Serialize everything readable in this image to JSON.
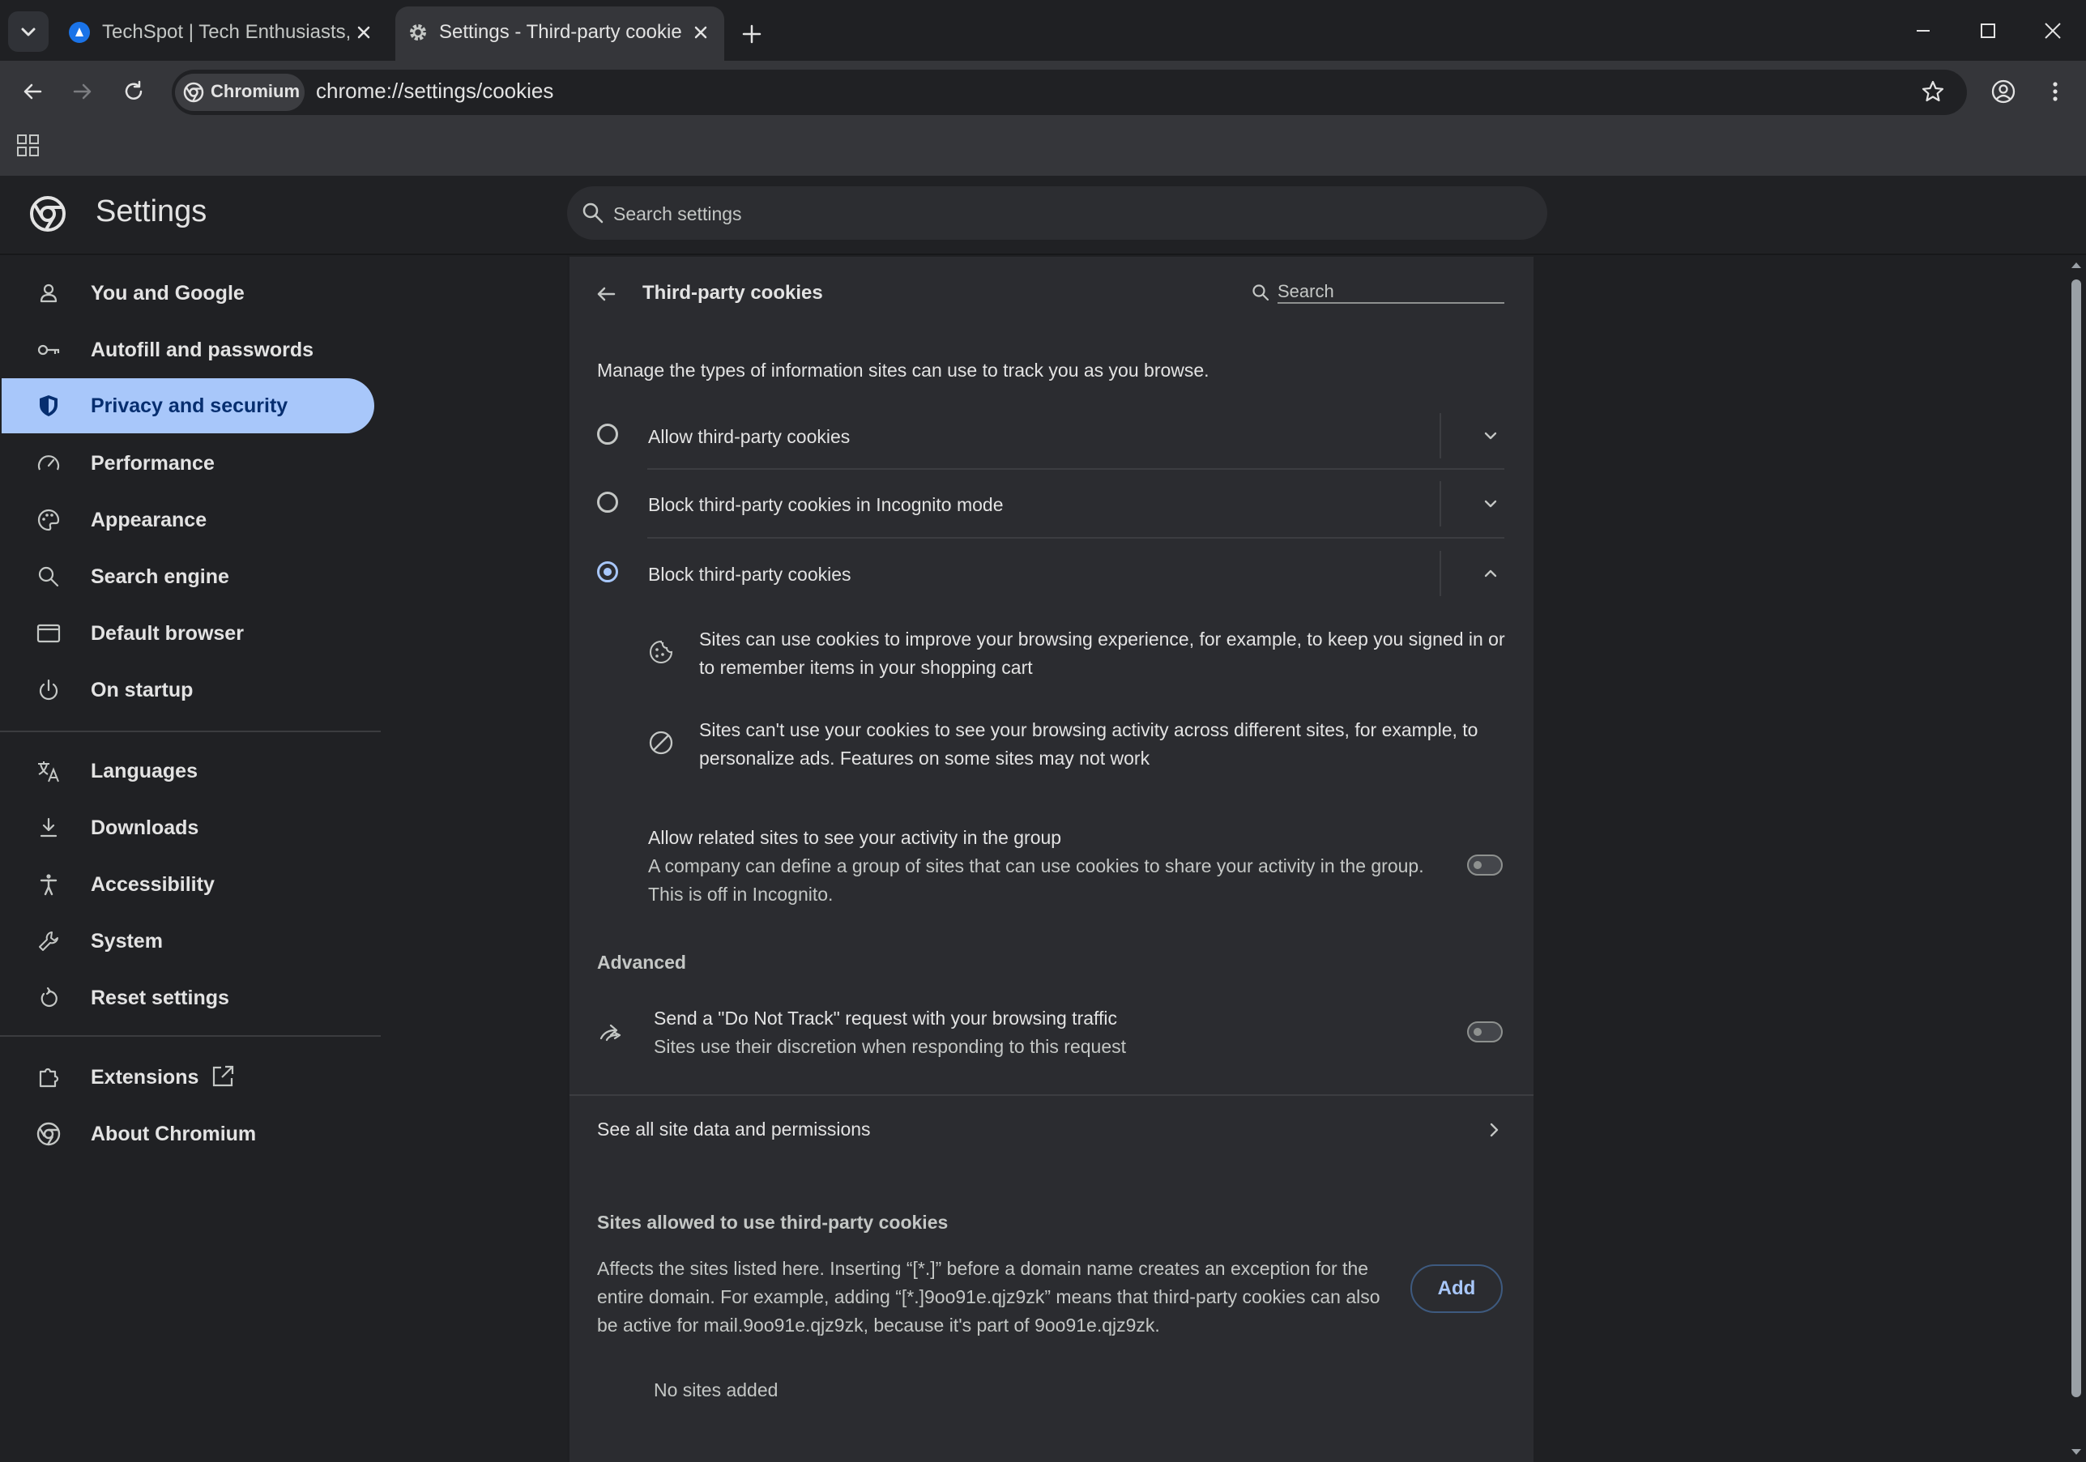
{
  "tabs": [
    {
      "title": "TechSpot | Tech Enthusiasts, Power Users, IT Professionals and Gamers",
      "active": false
    },
    {
      "title": "Settings - Third-party cookies",
      "active": true
    }
  ],
  "omnibox": {
    "chip_label": "Chromium",
    "url": "chrome://settings/cookies"
  },
  "header": {
    "title": "Settings",
    "search_placeholder": "Search settings"
  },
  "sidebar": {
    "items": [
      {
        "label": "You and Google",
        "icon": "person-icon"
      },
      {
        "label": "Autofill and passwords",
        "icon": "key-icon"
      },
      {
        "label": "Privacy and security",
        "icon": "shield-icon",
        "active": true
      },
      {
        "label": "Performance",
        "icon": "speedometer-icon"
      },
      {
        "label": "Appearance",
        "icon": "palette-icon"
      },
      {
        "label": "Search engine",
        "icon": "search-icon"
      },
      {
        "label": "Default browser",
        "icon": "browser-icon"
      },
      {
        "label": "On startup",
        "icon": "power-icon"
      },
      {
        "label": "Languages",
        "icon": "translate-icon"
      },
      {
        "label": "Downloads",
        "icon": "download-icon"
      },
      {
        "label": "Accessibility",
        "icon": "accessibility-icon"
      },
      {
        "label": "System",
        "icon": "wrench-icon"
      },
      {
        "label": "Reset settings",
        "icon": "reset-icon"
      },
      {
        "label": "Extensions",
        "icon": "puzzle-icon"
      },
      {
        "label": "About Chromium",
        "icon": "chromium-icon"
      }
    ]
  },
  "page": {
    "title": "Third-party cookies",
    "search_placeholder": "Search",
    "description": "Manage the types of information sites can use to track you as you browse.",
    "options": [
      {
        "label": "Allow third-party cookies",
        "selected": false
      },
      {
        "label": "Block third-party cookies in Incognito mode",
        "selected": false
      },
      {
        "label": "Block third-party cookies",
        "selected": true
      }
    ],
    "details": [
      {
        "line1": "Sites can use cookies to improve your browsing experience, for example, to keep you signed in or",
        "line2": "to remember items in your shopping cart"
      },
      {
        "line1": "Sites can't use your cookies to see your browsing activity across different sites, for example, to",
        "line2": "personalize ads. Features on some sites may not work"
      }
    ],
    "related_sites": {
      "title": "Allow related sites to see your activity in the group",
      "line1": "A company can define a group of sites that can use cookies to share your activity in the group.",
      "line2": "This is off in Incognito.",
      "enabled": false
    },
    "advanced_heading": "Advanced",
    "do_not_track": {
      "title": "Send a \"Do Not Track\" request with your browsing traffic",
      "subtitle": "Sites use their discretion when responding to this request",
      "enabled": false
    },
    "see_all_link": "See all site data and permissions",
    "allowed": {
      "heading": "Sites allowed to use third-party cookies",
      "line1": "Affects the sites listed here. Inserting “[*.]” before a domain name creates an exception for the",
      "line2": "entire domain. For example, adding “[*.]9oo91e.qjz9zk” means that third-party cookies can also",
      "line3": "be active for mail.9oo91e.qjz9zk, because it's part of 9oo91e.qjz9zk.",
      "add_label": "Add",
      "empty_text": "No sites added"
    }
  },
  "colors": {
    "accent": "#a8c7fa",
    "background": "#1f2023",
    "card": "#2b2c30"
  }
}
